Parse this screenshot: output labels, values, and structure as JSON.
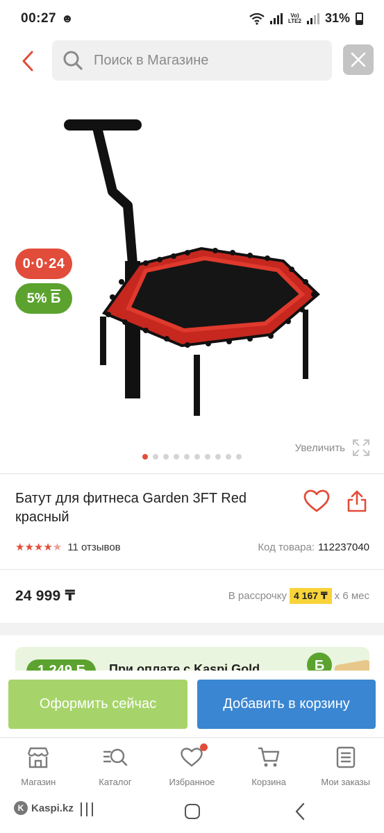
{
  "status_bar": {
    "time": "00:27",
    "battery": "31%",
    "volte": "Vo) LTE2"
  },
  "search": {
    "placeholder": "Поиск в Магазине"
  },
  "badges": {
    "installment": "0·0·24",
    "bonus_percent": "5%",
    "bonus_symbol": "Б"
  },
  "gallery": {
    "zoom_label": "Увеличить",
    "image_count": 10,
    "active_index": 0
  },
  "product": {
    "title": "Батут для фитнеса Garden 3FT Red красный",
    "rating": 4.5,
    "reviews": "11 отзывов",
    "sku_label": "Код товара:",
    "sku_value": "112237040",
    "price": "24 999 ₸",
    "installment_prefix": "В рассрочку",
    "installment_amount": "4 167 ₸",
    "installment_suffix": "x 6 мес"
  },
  "promo": {
    "amount": "1 249 Б",
    "text": "При оплате с Kaspi Gold"
  },
  "actions": {
    "order_now": "Оформить сейчас",
    "add_to_cart": "Добавить в корзину"
  },
  "bottom_nav": [
    {
      "label": "Магазин",
      "icon": "store-icon"
    },
    {
      "label": "Каталог",
      "icon": "catalog-search-icon"
    },
    {
      "label": "Избранное",
      "icon": "heart-icon"
    },
    {
      "label": "Корзина",
      "icon": "cart-icon"
    },
    {
      "label": "Мои заказы",
      "icon": "orders-icon"
    }
  ],
  "system_bar": {
    "brand": "Kaspi.kz"
  },
  "colors": {
    "accent_red": "#e24c3a",
    "green": "#5ba32e",
    "light_green_button": "#a6d46a",
    "blue_button": "#3a86d2",
    "installment_yellow": "#f8d33a"
  }
}
